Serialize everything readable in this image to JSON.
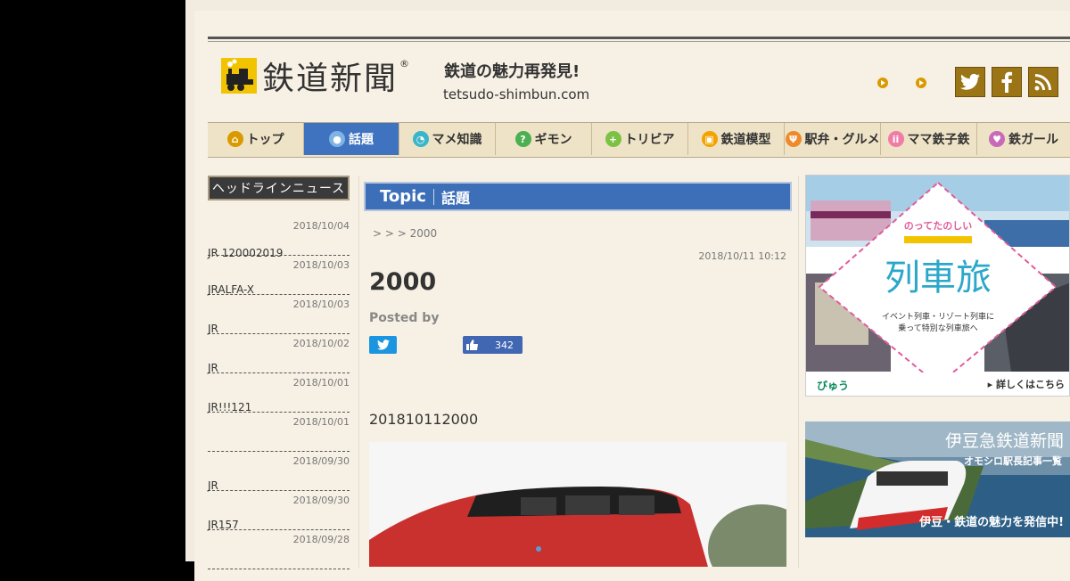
{
  "site": {
    "logo_text": "鉄道新聞",
    "logo_reg": "®",
    "tagline": "鉄道の魅力再発見!",
    "domain": "tetsudo-shimbun.com"
  },
  "nav": [
    {
      "label": "トップ",
      "color": "#d99a00",
      "icon": "home-icon"
    },
    {
      "label": "話題",
      "color": "#7fb3e6",
      "icon": "speech-bubble-icon"
    },
    {
      "label": "マメ知識",
      "color": "#3bb6c9",
      "icon": "bean-icon"
    },
    {
      "label": "ギモン",
      "color": "#4caf50",
      "icon": "question-icon"
    },
    {
      "label": "トリビア",
      "color": "#7cc242",
      "icon": "plus-icon"
    },
    {
      "label": "鉄道模型",
      "color": "#f3a300",
      "icon": "train-model-icon"
    },
    {
      "label": "駅弁・グルメ",
      "color": "#ef8a2b",
      "icon": "fork-icon"
    },
    {
      "label": "ママ鉄子鉄",
      "color": "#f07ca8",
      "icon": "family-icon"
    },
    {
      "label": "鉄ガール",
      "color": "#c96ab8",
      "icon": "heart-icon"
    }
  ],
  "sidebar": {
    "title": "ヘッドラインニュース",
    "items": [
      {
        "title": "",
        "date": "2018/10/04"
      },
      {
        "title": "JR 120002019",
        "date": "2018/10/03"
      },
      {
        "title": "JRALFA-X",
        "date": "2018/10/03"
      },
      {
        "title": "JR",
        "date": "2018/10/02"
      },
      {
        "title": "JR",
        "date": "2018/10/01"
      },
      {
        "title": "JR!!!121",
        "date": "2018/10/01"
      },
      {
        "title": "",
        "date": "2018/09/30"
      },
      {
        "title": "JR",
        "date": "2018/09/30"
      },
      {
        "title": "JR157",
        "date": "2018/09/28"
      }
    ]
  },
  "article": {
    "category_en": "Topic",
    "category_jp": "話題",
    "breadcrumb": "> > > 2000",
    "datetime": "2018/10/11 10:12",
    "title": "2000",
    "posted_by": "Posted by",
    "like_count": "342",
    "date_line": "201810112000"
  },
  "ads": {
    "ad1": {
      "title": "列車旅",
      "subtitle": "のってたのしい",
      "text1": "イベント列車・リゾート列車に",
      "text2": "乗って特別な列車旅へ",
      "brand": "びゅう",
      "link": "▸ 詳しくはこちら"
    },
    "ad2": {
      "title": "伊豆急鉄道新聞",
      "subtitle": "オモシロ駅長記事一覧",
      "footer": "伊豆・鉄道の魅力を発信中!"
    }
  }
}
